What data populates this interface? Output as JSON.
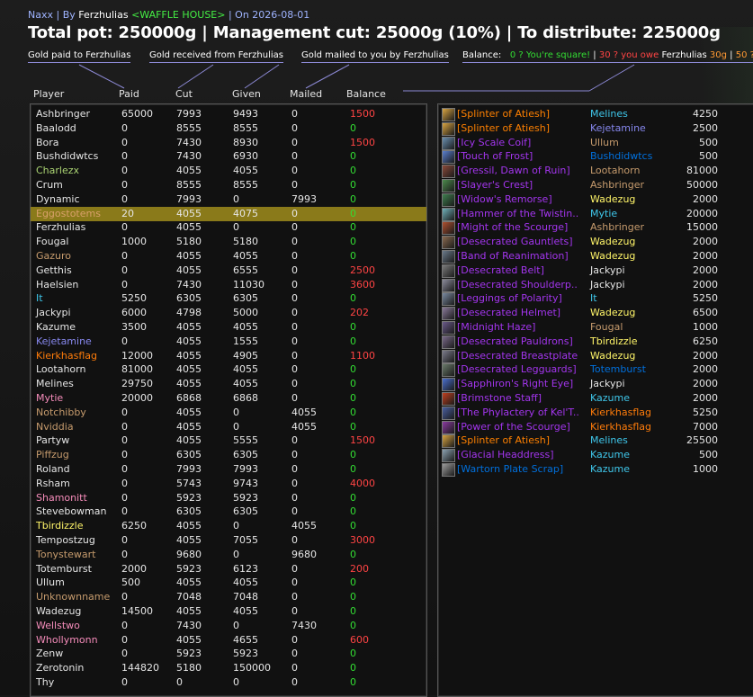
{
  "colors": {
    "epic": "#a335ee",
    "legendary": "#ff8000",
    "positive": "#ff4444",
    "zero": "#33dd33",
    "warlock": "#8788ee",
    "hunter": "#abd473",
    "rogue": "#fff569",
    "mage": "#3fc7eb",
    "druid": "#ff7c0a",
    "paladin": "#f58cba",
    "priest": "#ffffff",
    "warrior": "#c69b6d",
    "shaman": "#0070dd"
  },
  "header": {
    "raid": "Naxx",
    "by_label": " | By ",
    "author": "Ferzhulias",
    "guild": " <WAFFLE HOUSE>",
    "date": " | On 2026-08-01",
    "pot": "Total pot: 250000g | Management cut: 25000g (10%) | To distribute: 225000g"
  },
  "legend": {
    "paid": "Gold paid to Ferzhulias",
    "received": "Gold received from Ferzhulias",
    "mailed": "Gold mailed to you by Ferzhulias",
    "balance_label": "Balance:",
    "bal_square": "0 ? You're square!",
    "sep": " | ",
    "bal_owe": "30 ? you owe ",
    "bal_owe_name": "Ferzhulias",
    "bal_owe_amt": " 30g",
    "bal_tail": "50 ?"
  },
  "columns": {
    "player": "Player",
    "paid": "Paid",
    "cut": "Cut",
    "given": "Given",
    "mailed": "Mailed",
    "balance": "Balance"
  },
  "players": [
    {
      "name": "Ashbringer",
      "color": "#e6e6e6",
      "paid": "65000",
      "cut": "7993",
      "given": "9493",
      "mailed": "0",
      "balance": "1500",
      "bal_color": "#ff4444"
    },
    {
      "name": "Baalodd",
      "color": "#e6e6e6",
      "paid": "0",
      "cut": "8555",
      "given": "8555",
      "mailed": "0",
      "balance": "0",
      "bal_color": "#33dd33"
    },
    {
      "name": "Bora",
      "color": "#e6e6e6",
      "paid": "0",
      "cut": "7430",
      "given": "8930",
      "mailed": "0",
      "balance": "1500",
      "bal_color": "#ff4444"
    },
    {
      "name": "Bushdidwtcs",
      "color": "#e6e6e6",
      "paid": "0",
      "cut": "7430",
      "given": "6930",
      "mailed": "0",
      "balance": "0",
      "bal_color": "#33dd33"
    },
    {
      "name": "Charlezx",
      "color": "#abd473",
      "paid": "0",
      "cut": "4055",
      "given": "4055",
      "mailed": "0",
      "balance": "0",
      "bal_color": "#33dd33"
    },
    {
      "name": "Crum",
      "color": "#e6e6e6",
      "paid": "0",
      "cut": "8555",
      "given": "8555",
      "mailed": "0",
      "balance": "0",
      "bal_color": "#33dd33"
    },
    {
      "name": "Dynamic",
      "color": "#e6e6e6",
      "paid": "0",
      "cut": "7993",
      "given": "0",
      "mailed": "7993",
      "balance": "0",
      "bal_color": "#33dd33"
    },
    {
      "name": "Eggostotems",
      "color": "#d9a06a",
      "paid": "20",
      "cut": "4055",
      "given": "4075",
      "mailed": "0",
      "balance": "0",
      "bal_color": "#33dd33",
      "selected": true
    },
    {
      "name": "Ferzhulias",
      "color": "#e6e6e6",
      "paid": "0",
      "cut": "4055",
      "given": "0",
      "mailed": "0",
      "balance": "0",
      "bal_color": "#33dd33"
    },
    {
      "name": "Fougal",
      "color": "#e6e6e6",
      "paid": "1000",
      "cut": "5180",
      "given": "5180",
      "mailed": "0",
      "balance": "0",
      "bal_color": "#33dd33"
    },
    {
      "name": "Gazuro",
      "color": "#c69b6d",
      "paid": "0",
      "cut": "4055",
      "given": "4055",
      "mailed": "0",
      "balance": "0",
      "bal_color": "#33dd33"
    },
    {
      "name": "Getthis",
      "color": "#e6e6e6",
      "paid": "0",
      "cut": "4055",
      "given": "6555",
      "mailed": "0",
      "balance": "2500",
      "bal_color": "#ff4444"
    },
    {
      "name": "Haelsien",
      "color": "#e6e6e6",
      "paid": "0",
      "cut": "7430",
      "given": "11030",
      "mailed": "0",
      "balance": "3600",
      "bal_color": "#ff4444"
    },
    {
      "name": "It",
      "color": "#3fc7eb",
      "paid": "5250",
      "cut": "6305",
      "given": "6305",
      "mailed": "0",
      "balance": "0",
      "bal_color": "#33dd33"
    },
    {
      "name": "Jackypi",
      "color": "#e6e6e6",
      "paid": "6000",
      "cut": "4798",
      "given": "5000",
      "mailed": "0",
      "balance": "202",
      "bal_color": "#ff4444"
    },
    {
      "name": "Kazume",
      "color": "#e6e6e6",
      "paid": "3500",
      "cut": "4055",
      "given": "4055",
      "mailed": "0",
      "balance": "0",
      "bal_color": "#33dd33"
    },
    {
      "name": "Kejetamine",
      "color": "#8788ee",
      "paid": "0",
      "cut": "4055",
      "given": "1555",
      "mailed": "0",
      "balance": "0",
      "bal_color": "#33dd33"
    },
    {
      "name": "Kierkhasflag",
      "color": "#ff7c0a",
      "paid": "12000",
      "cut": "4055",
      "given": "4905",
      "mailed": "0",
      "balance": "1100",
      "bal_color": "#ff4444"
    },
    {
      "name": "Lootahorn",
      "color": "#e6e6e6",
      "paid": "81000",
      "cut": "4055",
      "given": "4055",
      "mailed": "0",
      "balance": "0",
      "bal_color": "#33dd33"
    },
    {
      "name": "Melines",
      "color": "#e6e6e6",
      "paid": "29750",
      "cut": "4055",
      "given": "4055",
      "mailed": "0",
      "balance": "0",
      "bal_color": "#33dd33"
    },
    {
      "name": "Mytie",
      "color": "#f58cba",
      "paid": "20000",
      "cut": "6868",
      "given": "6868",
      "mailed": "0",
      "balance": "0",
      "bal_color": "#33dd33"
    },
    {
      "name": "Notchibby",
      "color": "#c69b6d",
      "paid": "0",
      "cut": "4055",
      "given": "0",
      "mailed": "4055",
      "balance": "0",
      "bal_color": "#33dd33"
    },
    {
      "name": "Nviddia",
      "color": "#c69b6d",
      "paid": "0",
      "cut": "4055",
      "given": "0",
      "mailed": "4055",
      "balance": "0",
      "bal_color": "#33dd33"
    },
    {
      "name": "Partyw",
      "color": "#e6e6e6",
      "paid": "0",
      "cut": "4055",
      "given": "5555",
      "mailed": "0",
      "balance": "1500",
      "bal_color": "#ff4444"
    },
    {
      "name": "Piffzug",
      "color": "#c69b6d",
      "paid": "0",
      "cut": "6305",
      "given": "6305",
      "mailed": "0",
      "balance": "0",
      "bal_color": "#33dd33"
    },
    {
      "name": "Roland",
      "color": "#e6e6e6",
      "paid": "0",
      "cut": "7993",
      "given": "7993",
      "mailed": "0",
      "balance": "0",
      "bal_color": "#33dd33"
    },
    {
      "name": "Rsham",
      "color": "#e6e6e6",
      "paid": "0",
      "cut": "5743",
      "given": "9743",
      "mailed": "0",
      "balance": "4000",
      "bal_color": "#ff4444"
    },
    {
      "name": "Shamonitt",
      "color": "#f58cba",
      "paid": "0",
      "cut": "5923",
      "given": "5923",
      "mailed": "0",
      "balance": "0",
      "bal_color": "#33dd33"
    },
    {
      "name": "Stevebowman",
      "color": "#e6e6e6",
      "paid": "0",
      "cut": "6305",
      "given": "6305",
      "mailed": "0",
      "balance": "0",
      "bal_color": "#33dd33"
    },
    {
      "name": "Tbirdizzle",
      "color": "#fff569",
      "paid": "6250",
      "cut": "4055",
      "given": "0",
      "mailed": "4055",
      "balance": "0",
      "bal_color": "#33dd33"
    },
    {
      "name": "Tempostzug",
      "color": "#e6e6e6",
      "paid": "0",
      "cut": "4055",
      "given": "7055",
      "mailed": "0",
      "balance": "3000",
      "bal_color": "#ff4444"
    },
    {
      "name": "Tonystewart",
      "color": "#c69b6d",
      "paid": "0",
      "cut": "9680",
      "given": "0",
      "mailed": "9680",
      "balance": "0",
      "bal_color": "#33dd33"
    },
    {
      "name": "Totemburst",
      "color": "#e6e6e6",
      "paid": "2000",
      "cut": "5923",
      "given": "6123",
      "mailed": "0",
      "balance": "200",
      "bal_color": "#ff4444"
    },
    {
      "name": "Ullum",
      "color": "#e6e6e6",
      "paid": "500",
      "cut": "4055",
      "given": "4055",
      "mailed": "0",
      "balance": "0",
      "bal_color": "#33dd33"
    },
    {
      "name": "Unknownname",
      "color": "#c69b6d",
      "paid": "0",
      "cut": "7048",
      "given": "7048",
      "mailed": "0",
      "balance": "0",
      "bal_color": "#33dd33"
    },
    {
      "name": "Wadezug",
      "color": "#e6e6e6",
      "paid": "14500",
      "cut": "4055",
      "given": "4055",
      "mailed": "0",
      "balance": "0",
      "bal_color": "#33dd33"
    },
    {
      "name": "Wellstwo",
      "color": "#f58cba",
      "paid": "0",
      "cut": "7430",
      "given": "0",
      "mailed": "7430",
      "balance": "0",
      "bal_color": "#33dd33"
    },
    {
      "name": "Whollymonn",
      "color": "#f58cba",
      "paid": "0",
      "cut": "4055",
      "given": "4655",
      "mailed": "0",
      "balance": "600",
      "bal_color": "#ff4444"
    },
    {
      "name": "Zenw",
      "color": "#e6e6e6",
      "paid": "0",
      "cut": "5923",
      "given": "5923",
      "mailed": "0",
      "balance": "0",
      "bal_color": "#33dd33"
    },
    {
      "name": "Zerotonin",
      "color": "#e6e6e6",
      "paid": "144820",
      "cut": "5180",
      "given": "150000",
      "mailed": "0",
      "balance": "0",
      "bal_color": "#33dd33"
    },
    {
      "name": "Thy",
      "color": "#e6e6e6",
      "paid": "0",
      "cut": "0",
      "given": "0",
      "mailed": "0",
      "balance": "0",
      "bal_color": "#33dd33"
    }
  ],
  "items": [
    {
      "name": "[Splinter of Atiesh]",
      "color": "#ff8000",
      "winner": "Melines",
      "wcolor": "#3fc7eb",
      "amount": "4250",
      "icon": "splinter-icon",
      "iconc": "#d9a441"
    },
    {
      "name": "[Splinter of Atiesh]",
      "color": "#ff8000",
      "winner": "Kejetamine",
      "wcolor": "#8788ee",
      "amount": "2500",
      "icon": "splinter-icon",
      "iconc": "#d9a441"
    },
    {
      "name": "[Icy Scale Coif]",
      "color": "#a335ee",
      "winner": "Ullum",
      "wcolor": "#c69b6d",
      "amount": "500",
      "icon": "coif-icon",
      "iconc": "#6a8fb0"
    },
    {
      "name": "[Touch of Frost]",
      "color": "#a335ee",
      "winner": "Bushdidwtcs",
      "wcolor": "#0070dd",
      "amount": "500",
      "icon": "frost-icon",
      "iconc": "#5a7fcf"
    },
    {
      "name": "[Gressil, Dawn of Ruin]",
      "color": "#a335ee",
      "winner": "Lootahorn",
      "wcolor": "#c69b6d",
      "amount": "81000",
      "icon": "dagger-icon",
      "iconc": "#8b4a3a"
    },
    {
      "name": "[Slayer's Crest]",
      "color": "#a335ee",
      "winner": "Ashbringer",
      "wcolor": "#c69b6d",
      "amount": "50000",
      "icon": "crest-icon",
      "iconc": "#4d8b4d"
    },
    {
      "name": "[Widow's Remorse]",
      "color": "#a335ee",
      "winner": "Wadezug",
      "wcolor": "#fff569",
      "amount": "2000",
      "icon": "sword-icon",
      "iconc": "#3f7f4f"
    },
    {
      "name": "[Hammer of the Twistin...",
      "color": "#a335ee",
      "winner": "Mytie",
      "wcolor": "#3fc7eb",
      "amount": "20000",
      "icon": "hammer-icon",
      "iconc": "#6fb0b8"
    },
    {
      "name": "[Might of the Scourge]",
      "color": "#a335ee",
      "winner": "Ashbringer",
      "wcolor": "#c69b6d",
      "amount": "15000",
      "icon": "shoulder-icon",
      "iconc": "#b05030"
    },
    {
      "name": "[Desecrated Gauntlets]",
      "color": "#a335ee",
      "winner": "Wadezug",
      "wcolor": "#fff569",
      "amount": "2000",
      "icon": "gauntlets-icon",
      "iconc": "#8a6a50"
    },
    {
      "name": "[Band of Reanimation]",
      "color": "#a335ee",
      "winner": "Wadezug",
      "wcolor": "#fff569",
      "amount": "2000",
      "icon": "ring-icon",
      "iconc": "#6a7a8a"
    },
    {
      "name": "[Desecrated Belt]",
      "color": "#a335ee",
      "winner": "Jackypi",
      "wcolor": "#e6e6e6",
      "amount": "2000",
      "icon": "belt-icon",
      "iconc": "#7a7a7a"
    },
    {
      "name": "[Desecrated Shoulderp...",
      "color": "#a335ee",
      "winner": "Jackypi",
      "wcolor": "#e6e6e6",
      "amount": "2000",
      "icon": "shoulder-icon",
      "iconc": "#8a8a9a"
    },
    {
      "name": "[Leggings of Polarity]",
      "color": "#a335ee",
      "winner": "It",
      "wcolor": "#3fc7eb",
      "amount": "5250",
      "icon": "leggings-icon",
      "iconc": "#7a8aa0"
    },
    {
      "name": "[Desecrated Helmet]",
      "color": "#a335ee",
      "winner": "Wadezug",
      "wcolor": "#fff569",
      "amount": "6500",
      "icon": "helmet-icon",
      "iconc": "#8a7a9a"
    },
    {
      "name": "[Midnight Haze]",
      "color": "#a335ee",
      "winner": "Fougal",
      "wcolor": "#c69b6d",
      "amount": "1000",
      "icon": "cloak-icon",
      "iconc": "#6a5a8a"
    },
    {
      "name": "[Desecrated Pauldrons]",
      "color": "#a335ee",
      "winner": "Tbirdizzle",
      "wcolor": "#fff569",
      "amount": "6250",
      "icon": "shoulder-icon",
      "iconc": "#7a6a8a"
    },
    {
      "name": "[Desecrated Breastplate]",
      "color": "#a335ee",
      "winner": "Wadezug",
      "wcolor": "#fff569",
      "amount": "2000",
      "icon": "chest-icon",
      "iconc": "#7a7a8a"
    },
    {
      "name": "[Desecrated Legguards]",
      "color": "#a335ee",
      "winner": "Totemburst",
      "wcolor": "#0070dd",
      "amount": "2000",
      "icon": "leggings-icon",
      "iconc": "#6a7a6a"
    },
    {
      "name": "[Sapphiron's Right Eye]",
      "color": "#a335ee",
      "winner": "Jackypi",
      "wcolor": "#e6e6e6",
      "amount": "2000",
      "icon": "eye-icon",
      "iconc": "#4a6fcf"
    },
    {
      "name": "[Brimstone Staff]",
      "color": "#a335ee",
      "winner": "Kazume",
      "wcolor": "#3fc7eb",
      "amount": "2000",
      "icon": "staff-icon",
      "iconc": "#c04020"
    },
    {
      "name": "[The Phylactery of Kel'T...",
      "color": "#a335ee",
      "winner": "Kierkhasflag",
      "wcolor": "#ff7c0a",
      "amount": "5250",
      "icon": "phylactery-icon",
      "iconc": "#4a5fa0"
    },
    {
      "name": "[Power of the Scourge]",
      "color": "#a335ee",
      "winner": "Kierkhasflag",
      "wcolor": "#ff7c0a",
      "amount": "7000",
      "icon": "shoulder-icon",
      "iconc": "#8a3aa0"
    },
    {
      "name": "[Splinter of Atiesh]",
      "color": "#ff8000",
      "winner": "Melines",
      "wcolor": "#3fc7eb",
      "amount": "25500",
      "icon": "splinter-icon",
      "iconc": "#d9a441"
    },
    {
      "name": "[Glacial Headdress]",
      "color": "#a335ee",
      "winner": "Kazume",
      "wcolor": "#3fc7eb",
      "amount": "500",
      "icon": "headdress-icon",
      "iconc": "#8aa0b0"
    },
    {
      "name": "[Wartorn Plate Scrap]",
      "color": "#0070dd",
      "winner": "Kazume",
      "wcolor": "#3fc7eb",
      "amount": "1000",
      "icon": "scrap-icon",
      "iconc": "#9a9a9a"
    }
  ]
}
